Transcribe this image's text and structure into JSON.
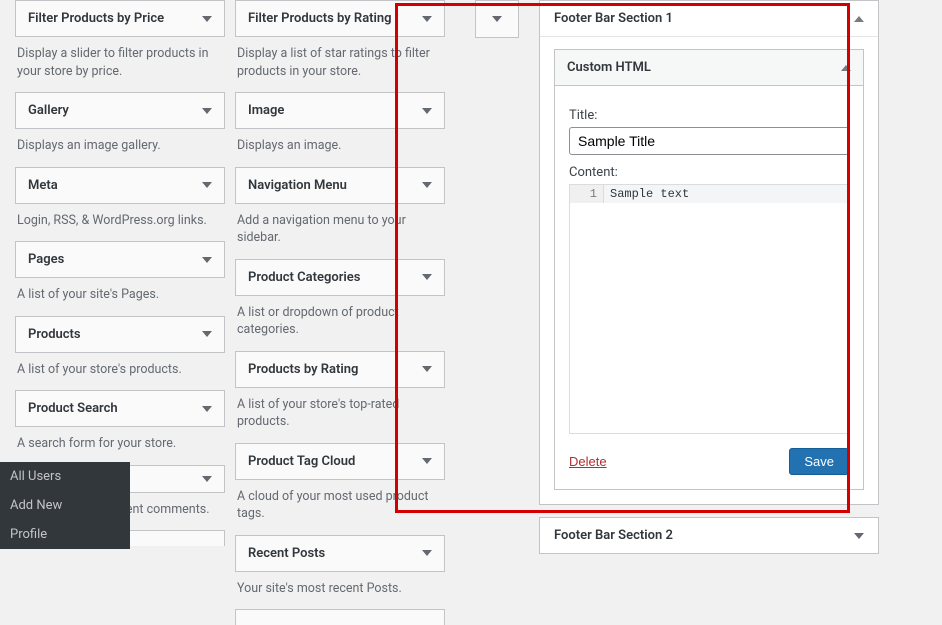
{
  "left": [
    {
      "title": "Filter Products by Price",
      "desc": "Display a slider to filter products in your store by price."
    },
    {
      "title": "Gallery",
      "desc": "Displays an image gallery."
    },
    {
      "title": "Meta",
      "desc": "Login, RSS, & WordPress.org links."
    },
    {
      "title": "Pages",
      "desc": "A list of your site's Pages."
    },
    {
      "title": "Products",
      "desc": "A list of your store's products."
    },
    {
      "title": "Product Search",
      "desc": "A search form for your store."
    }
  ],
  "left_partial": {
    "title": "",
    "desc": "Your site's most recent comments."
  },
  "mid": [
    {
      "title": "Filter Products by Rating",
      "desc": "Display a list of star ratings to filter products in your store."
    },
    {
      "title": "Image",
      "desc": "Displays an image."
    },
    {
      "title": "Navigation Menu",
      "desc": "Add a navigation menu to your sidebar."
    },
    {
      "title": "Product Categories",
      "desc": "A list or dropdown of product categories."
    },
    {
      "title": "Products by Rating",
      "desc": "A list of your store's top-rated products."
    },
    {
      "title": "Product Tag Cloud",
      "desc": "A cloud of your most used product tags."
    },
    {
      "title": "Recent Posts",
      "desc": "Your site's most recent Posts."
    }
  ],
  "right": {
    "section1_title": "Footer Bar Section 1",
    "inner_widget_title": "Custom HTML",
    "title_label": "Title:",
    "title_value": "Sample Title",
    "content_label": "Content:",
    "line_no": "1",
    "content_value": "Sample text",
    "delete_label": "Delete",
    "save_label": "Save",
    "section2_title": "Footer Bar Section 2"
  },
  "float_menu": [
    "All Users",
    "Add New",
    "Profile"
  ]
}
